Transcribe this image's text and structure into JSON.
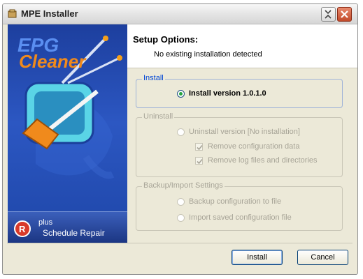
{
  "window": {
    "title": "MPE Installer"
  },
  "titlebar_buttons": {
    "help_icon": "help-icon",
    "close_icon": "close-icon"
  },
  "sidebar": {
    "logo_line1": "EPG",
    "logo_line2": "Cleaner",
    "plus_label": "plus",
    "plus_name": "Schedule Repair"
  },
  "header": {
    "title": "Setup Options:",
    "subtitle": "No existing installation detected"
  },
  "install_group": {
    "legend": "Install",
    "option_label": "Install version 1.0.1.0",
    "selected": true
  },
  "uninstall_group": {
    "legend": "Uninstall",
    "option_label": "Uninstall version [No installation]",
    "remove_config_label": "Remove configuration data",
    "remove_config_checked": true,
    "remove_logs_label": "Remove log files and directories",
    "remove_logs_checked": true
  },
  "backup_group": {
    "legend": "Backup/Import Settings",
    "backup_label": "Backup configuration to file",
    "import_label": "Import saved configuration file"
  },
  "buttons": {
    "install": "Install",
    "cancel": "Cancel"
  },
  "colors": {
    "sidebar_blue": "#2c57c2",
    "logo_orange": "#f08a1c",
    "selected_radio": "#24a341",
    "group_legend_active": "#0046d5",
    "disabled_text": "#a7a497"
  }
}
